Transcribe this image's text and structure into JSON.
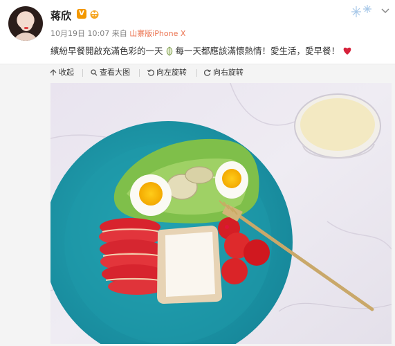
{
  "post": {
    "author_name": "蒋欣",
    "verified_badge": "V",
    "meta_date": "10月19日 10:07",
    "meta_from": "来自",
    "meta_source": "山寨版iPhone X",
    "text_part1": "繽紛早餐開啟充滿色彩的一天",
    "text_part2": "每一天都應該滿懷熱情！愛生活，愛早餐！",
    "icons": [
      "crown-icon",
      "leaf-icon",
      "heart-icon",
      "chevron-down-icon"
    ]
  },
  "toolbar": {
    "items": [
      {
        "label": "收起",
        "icon": "collapse-icon"
      },
      {
        "label": "查看大图",
        "icon": "zoom-icon"
      },
      {
        "label": "向左旋转",
        "icon": "rotate-left-icon"
      },
      {
        "label": "向右旋转",
        "icon": "rotate-right-icon"
      }
    ]
  },
  "colors": {
    "accent": "#eb7350",
    "badge": "#f39800",
    "plate": "#1f9aa8",
    "heart": "#d6213a"
  }
}
